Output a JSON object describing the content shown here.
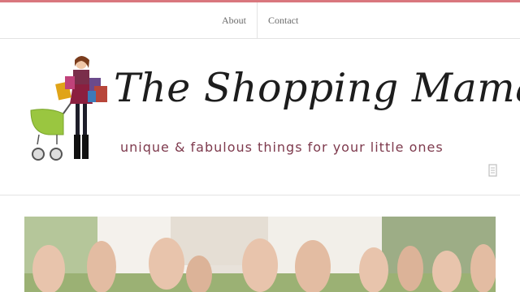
{
  "nav": {
    "items": [
      {
        "label": "About"
      },
      {
        "label": "Contact"
      }
    ]
  },
  "header": {
    "title": "The Shopping Mama",
    "tagline": "unique & fabulous things  for your little ones"
  },
  "icons": {
    "logo": "shopping-mama-with-stroller",
    "menu": "menu-toggle-icon"
  },
  "hero": {
    "image": "family-bare-feet-photo"
  },
  "colors": {
    "accent_strip": "#d9777e",
    "tagline": "#7e3a4d",
    "title": "#1d1d1d",
    "nav_text": "#6b6b6b",
    "stroller": "#9ac640"
  }
}
